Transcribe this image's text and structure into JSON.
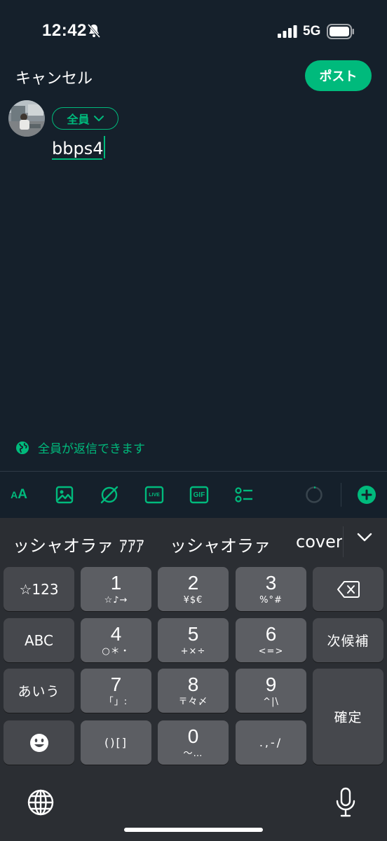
{
  "status_bar": {
    "time": "12:42",
    "network": "5G",
    "icons": [
      "bell-slash-icon",
      "signal-icon",
      "battery-icon"
    ]
  },
  "header": {
    "cancel_label": "キャンセル",
    "post_label": "ポスト"
  },
  "compose": {
    "audience_label": "全員",
    "text": "bbps4"
  },
  "reply_setting": {
    "label": "全員が返信できます",
    "icon": "globe-icon"
  },
  "toolbar": {
    "font_small": "A",
    "font_big": "A",
    "icons": [
      "text-size-icon",
      "image-icon",
      "no-entry-icon",
      "live-icon",
      "gif-icon",
      "poll-icon",
      "progress-ring-icon",
      "add-icon"
    ],
    "live_label": "LIVE",
    "gif_label": "GIF"
  },
  "keyboard": {
    "suggestions": [
      "ッシャオラァ ｱｱｱ",
      "ッシャオラァ",
      "cover"
    ],
    "keys": {
      "sym": "☆123",
      "abc": "ABC",
      "kana": "あいう",
      "delete": "delete",
      "next_candidate": "次候補",
      "confirm": "確定",
      "k1": {
        "main": "1",
        "sub": "☆♪→"
      },
      "k2": {
        "main": "2",
        "sub": "¥$€"
      },
      "k3": {
        "main": "3",
        "sub": "%°#"
      },
      "k4": {
        "main": "4",
        "sub": "○＊・"
      },
      "k5": {
        "main": "5",
        "sub": "+×÷"
      },
      "k6": {
        "main": "6",
        "sub": "<=>"
      },
      "k7": {
        "main": "7",
        "sub": "「」:"
      },
      "k8": {
        "main": "8",
        "sub": "〒々〆"
      },
      "k9": {
        "main": "9",
        "sub": "^|\\"
      },
      "k0": {
        "main": "0",
        "sub": "〜…"
      },
      "brackets": "()[]",
      "punct": ".,-/"
    }
  },
  "colors": {
    "background": "#15202b",
    "accent": "#00ba7c",
    "keyboard_bg": "#2b2e33",
    "key": "#5c5e63",
    "key_fn": "#46484d"
  }
}
